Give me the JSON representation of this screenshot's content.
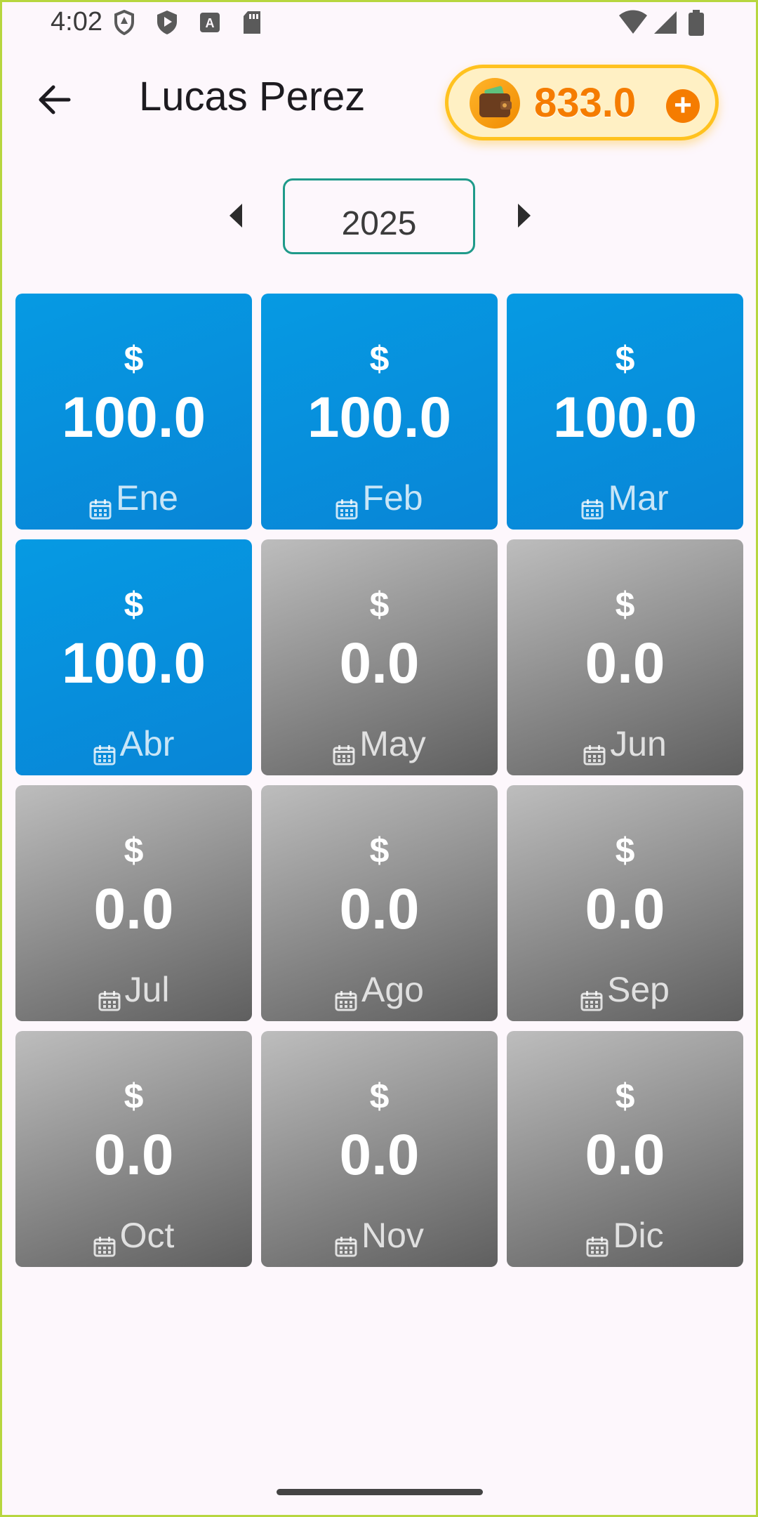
{
  "status_bar": {
    "time": "4:02",
    "left_icons": [
      "shield-icon",
      "play-protect-icon",
      "a-icon",
      "sd-card-icon"
    ],
    "right_icons": [
      "wifi-icon",
      "signal-icon",
      "battery-icon"
    ]
  },
  "header": {
    "back_icon": "arrow-back-icon",
    "title": "Lucas Perez",
    "balance": "833.0",
    "add_icon": "plus-icon"
  },
  "year_selector": {
    "year": "2025",
    "prev_icon": "arrow-left-icon",
    "next_icon": "arrow-right-icon"
  },
  "months": [
    {
      "label": "Ene",
      "currency": "$",
      "amount": "100.0",
      "paid": true
    },
    {
      "label": "Feb",
      "currency": "$",
      "amount": "100.0",
      "paid": true
    },
    {
      "label": "Mar",
      "currency": "$",
      "amount": "100.0",
      "paid": true
    },
    {
      "label": "Abr",
      "currency": "$",
      "amount": "100.0",
      "paid": true
    },
    {
      "label": "May",
      "currency": "$",
      "amount": "0.0",
      "paid": false
    },
    {
      "label": "Jun",
      "currency": "$",
      "amount": "0.0",
      "paid": false
    },
    {
      "label": "Jul",
      "currency": "$",
      "amount": "0.0",
      "paid": false
    },
    {
      "label": "Ago",
      "currency": "$",
      "amount": "0.0",
      "paid": false
    },
    {
      "label": "Sep",
      "currency": "$",
      "amount": "0.0",
      "paid": false
    },
    {
      "label": "Oct",
      "currency": "$",
      "amount": "0.0",
      "paid": false
    },
    {
      "label": "Nov",
      "currency": "$",
      "amount": "0.0",
      "paid": false
    },
    {
      "label": "Dic",
      "currency": "$",
      "amount": "0.0",
      "paid": false
    }
  ],
  "colors": {
    "paid": "#0891da",
    "unpaid": "#8e8e8e",
    "accent": "#f57c00",
    "outline": "#1f9a8a"
  }
}
